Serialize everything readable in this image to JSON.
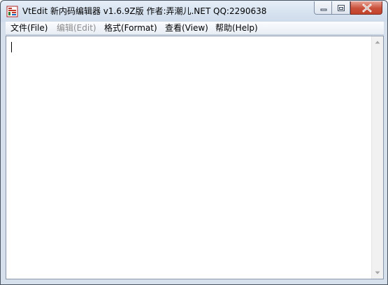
{
  "window": {
    "title": "VtEdit 新内码编辑器 v1.6.9Z版 作者:弄潮儿.NET QQ:2290638",
    "icon": "app-icon"
  },
  "controls": {
    "minimize": "minimize-icon",
    "maximize": "restore-icon",
    "close": "close-icon"
  },
  "menu": {
    "items": [
      {
        "label": "文件(File)",
        "enabled": true
      },
      {
        "label": "编辑(Edit)",
        "enabled": false
      },
      {
        "label": "格式(Format)",
        "enabled": true
      },
      {
        "label": "查看(View)",
        "enabled": true
      },
      {
        "label": "帮助(Help)",
        "enabled": true
      }
    ]
  },
  "editor": {
    "content": ""
  },
  "colors": {
    "frame": "#d6e0ec",
    "close_button": "#c9503a",
    "disabled_text": "#8d8d8d"
  }
}
